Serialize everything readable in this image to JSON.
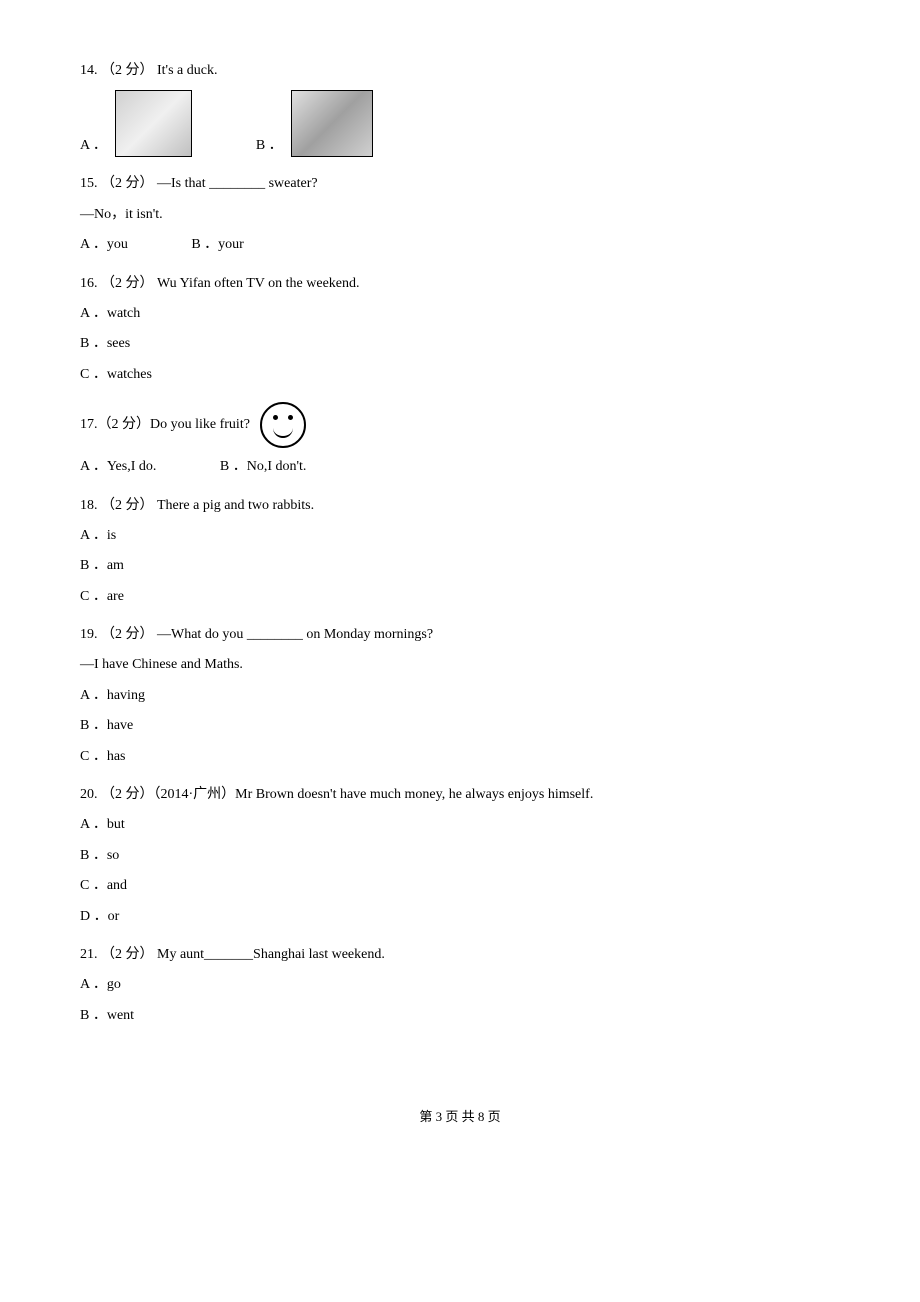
{
  "q14": {
    "number": "14. ",
    "points": "（2 分）",
    "text": " It's a duck.",
    "optA_label": "A ．",
    "optB_label": "B ．"
  },
  "q15": {
    "number": "15. ",
    "points": "（2 分）",
    "text": " —Is that ________ sweater?",
    "line2": "—No，it isn't.",
    "optA": "A ．you",
    "optB": "B ．your"
  },
  "q16": {
    "number": "16. ",
    "points": "（2 分）",
    "text": " Wu Yifan often      TV on the weekend.",
    "optA": "A ．watch",
    "optB": "B ．sees",
    "optC": "C ．watches"
  },
  "q17": {
    "number": "17. ",
    "points": "（2 分）",
    "text": " Do you like fruit?  ",
    "optA": "A ．Yes,I do.",
    "optB": "B ．No,I don't."
  },
  "q18": {
    "number": "18. ",
    "points": "（2 分）",
    "text": " There            a pig and two rabbits.",
    "optA": "A ．is",
    "optB": "B ．am",
    "optC": "C ．are"
  },
  "q19": {
    "number": "19. ",
    "points": "（2 分）",
    "text": " —What do you ________ on Monday mornings?",
    "line2": "—I have Chinese and Maths.",
    "optA": "A ．having",
    "optB": "B ．have",
    "optC": "C ．has"
  },
  "q20": {
    "number": "20. ",
    "points": "（2 分）",
    "source": "（2014·广州）",
    "text": "Mr Brown doesn't have much money,           he always enjoys himself.",
    "optA": "A ．but",
    "optB": "B ．so",
    "optC": "C ．and",
    "optD": "D ．or"
  },
  "q21": {
    "number": "21. ",
    "points": "（2 分）",
    "text": " My aunt_______Shanghai last weekend.",
    "optA": "A ．go",
    "optB": "B ．went"
  },
  "footer": "第 3 页 共 8 页"
}
